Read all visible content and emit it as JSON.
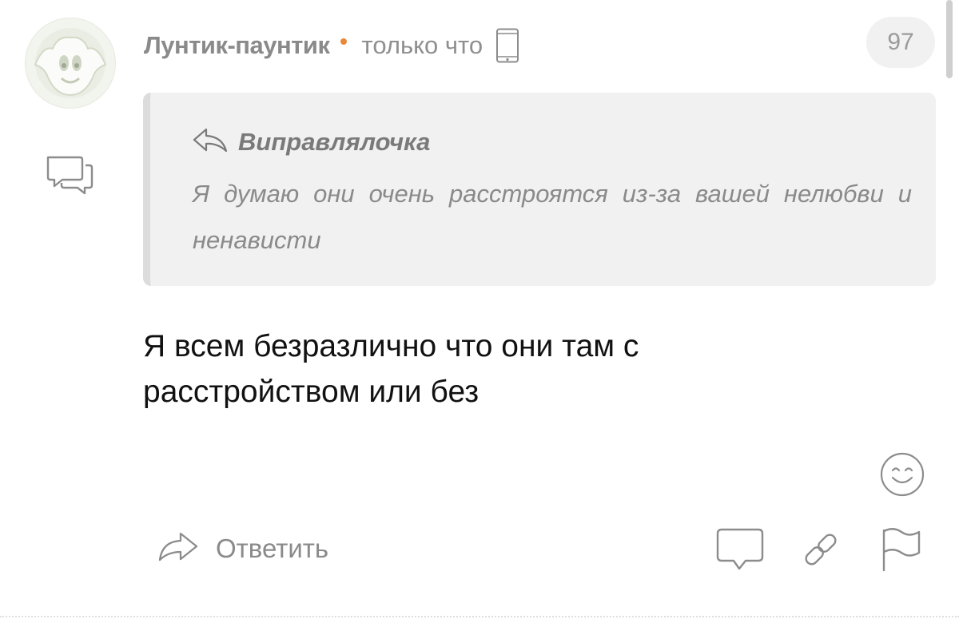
{
  "comment": {
    "author": "Лунтик-паунтик",
    "timestamp": "только что",
    "rating": "97",
    "text": "Я всем безразлично что они там с расстройством или без"
  },
  "quote": {
    "author": "Виправлялочка",
    "text": "Я думаю они очень расстроятся из-за вашей нелюбви и ненависти"
  },
  "actions": {
    "reply_label": "Ответить"
  },
  "colors": {
    "accent_dot": "#e8883a",
    "icon_gray": "#8c8c8c",
    "quote_background": "#f1f1f1"
  },
  "icons": {
    "device": "smartphone-icon",
    "thread": "comments-icon",
    "quote_reply": "reply-arrow-icon",
    "emoji": "smiley-icon",
    "reply": "reply-arrow-icon",
    "comment": "speech-bubble-icon",
    "link": "link-icon",
    "report": "flag-icon"
  }
}
